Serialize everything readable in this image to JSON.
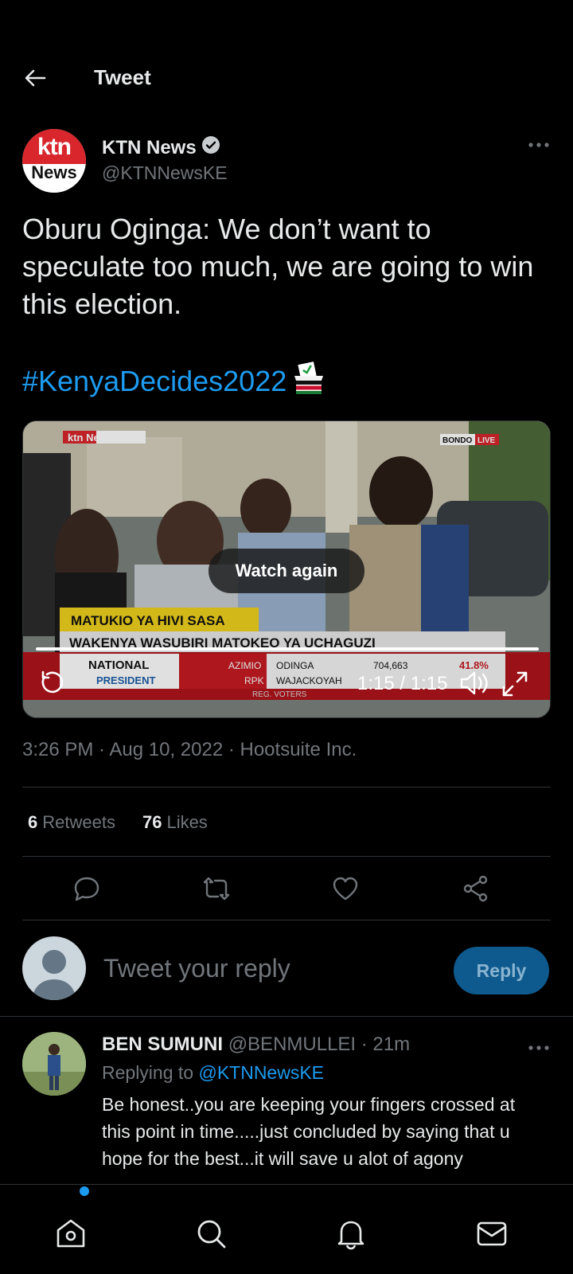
{
  "header": {
    "title": "Tweet"
  },
  "tweet": {
    "author_name": "KTN News",
    "author_handle": "@KTNNewsKE",
    "avatar_text_top": "ktn",
    "avatar_text_bottom": "News",
    "text": "Oburu Oginga: We don’t want to speculate too much, we are going to win this election.",
    "hashtag": "#KenyaDecides2022",
    "timestamp": "3:26 PM · Aug 10, 2022 · Hootsuite Inc.",
    "retweets_count": "6",
    "retweets_label": "Retweets",
    "likes_count": "76",
    "likes_label": "Likes"
  },
  "video": {
    "watch_again_label": "Watch again",
    "time": "1:15 / 1:15",
    "progress": 1.0,
    "station_logo": "ktn News",
    "location_tag": "BONDO",
    "live_tag": "LIVE",
    "ticker_headline": "MATUKIO YA HIVI SASA",
    "ticker_sub": "WAKENYA WASUBIRI MATOKEO YA UCHAGUZI",
    "scoreboard": {
      "left_top": "NATIONAL",
      "left_bottom": "PRESIDENT",
      "party1": "AZIMIO",
      "party2": "RPK",
      "cand1": "ODINGA",
      "cand2": "WAJACKOYAH",
      "votes1": "704,663",
      "pct1": "41.8%",
      "footer": "REG. VOTERS"
    }
  },
  "compose": {
    "placeholder": "Tweet your reply",
    "reply_label": "Reply"
  },
  "reply": {
    "name": "BEN SUMUNI",
    "handle_time": "@BENMULLEI · 21m",
    "replying_label": "Replying to",
    "replying_handle": "@KTNNewsKE",
    "text": "Be honest..you are keeping your fingers crossed at this point in time.....just concluded by saying that u hope for the best...it will save u alot of agony"
  },
  "colors": {
    "accent": "#1d9bf0",
    "background": "#000000",
    "muted": "#71767b"
  }
}
